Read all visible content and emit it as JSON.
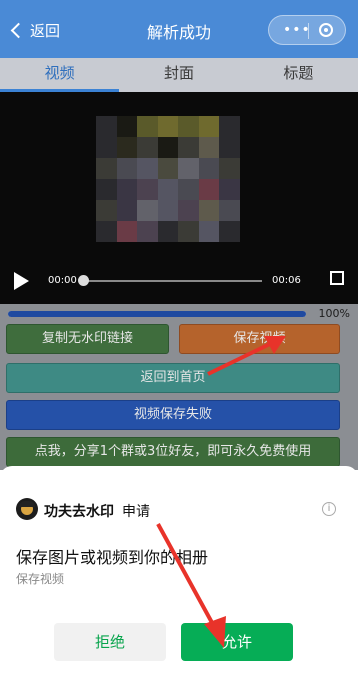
{
  "nav": {
    "back_label": "返回",
    "title": "解析成功",
    "capsule_dots": "•••"
  },
  "tabs": [
    {
      "label": "视频",
      "active": true
    },
    {
      "label": "封面",
      "active": false
    },
    {
      "label": "标题",
      "active": false
    }
  ],
  "player": {
    "current_time": "00:00",
    "duration": "00:06"
  },
  "progress": {
    "value_percent": 100,
    "label": "100%"
  },
  "buttons": {
    "copy_link": "复制无水印链接",
    "save_video": "保存视频",
    "back_home": "返回到首页",
    "save_failed": "视频保存失败",
    "share": "点我，分享1个群或3位好友，即可永久免费使用"
  },
  "auth_sheet": {
    "app_name": "功夫去水印",
    "request_word": "申请",
    "question": "保存图片或视频到你的相册",
    "scope": "保存视频",
    "info_glyph": "i",
    "deny_label": "拒绝",
    "allow_label": "允许"
  },
  "colors": {
    "nav_bg": "#4a8ad6",
    "accent_arrow": "#e8332a",
    "allow_green": "#06ad56"
  },
  "icons": [
    "back-chevron-icon",
    "more-dots-icon",
    "close-circle-icon",
    "play-icon",
    "fullscreen-icon",
    "info-icon",
    "app-avatar-icon"
  ]
}
